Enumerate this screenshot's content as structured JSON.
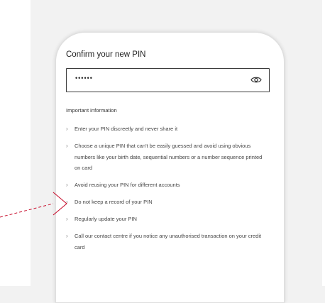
{
  "pin": {
    "label": "Confirm your new PIN",
    "value": "••••••"
  },
  "info": {
    "title": "Important information",
    "items": [
      "Enter your PIN discreetly and never share it",
      "Choose a unique PIN that can't be easily guessed and avoid using obvious numbers like your birth date, sequential numbers or a number sequence printed on card",
      "Avoid reusing your PIN for different accounts",
      "Do not keep a record of your PIN",
      "Regularly update your PIN",
      "Call our contact centre if you notice any unauthorised transaction on your credit card"
    ]
  },
  "colors": {
    "annotation": "#c8102e",
    "background": "#f2f2f2"
  },
  "icons": {
    "pin_toggle": "eye-icon",
    "annotation": "red-arrow-pointer"
  }
}
